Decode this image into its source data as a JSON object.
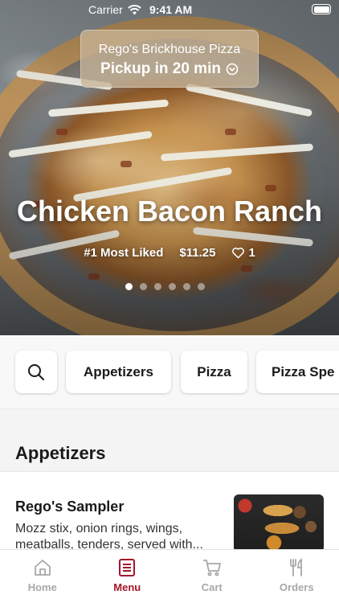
{
  "status_bar": {
    "carrier": "Carrier",
    "time": "9:41 AM"
  },
  "pickup": {
    "store_name": "Rego's Brickhouse Pizza",
    "eta_label": "Pickup in 20 min"
  },
  "featured": {
    "title": "Chicken Bacon Ranch",
    "badge": "#1 Most Liked",
    "price": "$11.25",
    "likes": "1",
    "carousel_count": 6,
    "carousel_active": 1
  },
  "categories": [
    "Appetizers",
    "Pizza",
    "Pizza Spe"
  ],
  "section": {
    "title": "Appetizers"
  },
  "menu_items": [
    {
      "name": "Rego's Sampler",
      "description": "Mozz stix, onion rings, wings, meatballs, tenders, served with..."
    }
  ],
  "tabs": [
    {
      "label": "Home",
      "icon": "home-icon",
      "active": false
    },
    {
      "label": "Menu",
      "icon": "menu-icon",
      "active": true
    },
    {
      "label": "Cart",
      "icon": "cart-icon",
      "active": false
    },
    {
      "label": "Orders",
      "icon": "fork-knife-icon",
      "active": false
    }
  ],
  "colors": {
    "accent": "#a5162a",
    "tab_inactive": "#a8a8a8"
  }
}
